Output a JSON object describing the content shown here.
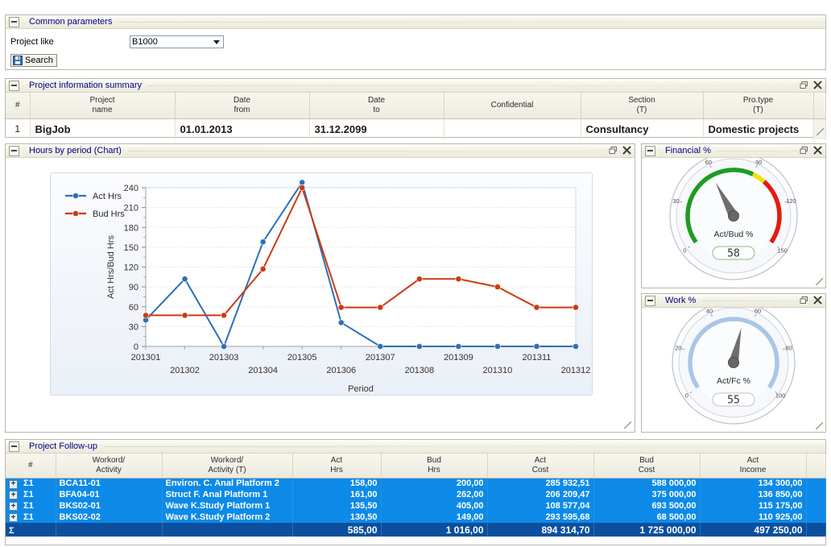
{
  "common": {
    "title": "Common parameters",
    "collapse_icon": "minus-icon",
    "project_like_label": "Project like",
    "project_like_value": "B1000",
    "search_label": "Search",
    "search_icon": "save-disk-icon"
  },
  "info": {
    "title": "Project information summary",
    "restore_icon": "restore-icon",
    "close_icon": "close-icon",
    "columns": [
      "#",
      "Project\nname",
      "Date\nfrom",
      "Date\nto",
      "Confidential",
      "Section\n(T)",
      "Pro.type\n(T)"
    ],
    "col_index": "#",
    "col_project_name_l1": "Project",
    "col_project_name_l2": "name",
    "col_date_from_l1": "Date",
    "col_date_from_l2": "from",
    "col_date_to_l1": "Date",
    "col_date_to_l2": "to",
    "col_confidential": "Confidential",
    "col_section_l1": "Section",
    "col_section_l2": "(T)",
    "col_protype_l1": "Pro.type",
    "col_protype_l2": "(T)",
    "rows": [
      {
        "index": "1",
        "project_name": "BigJob",
        "date_from": "01.01.2013",
        "date_to": "31.12.2099",
        "confidential": "",
        "section": "Consultancy",
        "pro_type": "Domestic projects"
      }
    ]
  },
  "chart_panel": {
    "title": "Hours by period (Chart)",
    "restore_icon": "restore-icon",
    "close_icon": "close-icon"
  },
  "chart_data": {
    "type": "line",
    "title": "Hours by period (Chart)",
    "xlabel": "Period",
    "ylabel": "Act Hrs/Bud Hrs",
    "ylim": [
      0,
      240
    ],
    "yticks": [
      0,
      30,
      60,
      90,
      120,
      150,
      180,
      210,
      240
    ],
    "grid": true,
    "legend_position": "top-left",
    "categories": [
      "201301",
      "201302",
      "201303",
      "201304",
      "201305",
      "201306",
      "201307",
      "201308",
      "201309",
      "201310",
      "201311",
      "201312"
    ],
    "series": [
      {
        "name": "Act Hrs",
        "color": "#2f6fb5",
        "values": [
          40,
          102,
          0,
          158,
          248,
          36,
          0,
          0,
          0,
          0,
          0,
          0
        ]
      },
      {
        "name": "Bud Hrs",
        "color": "#cc3a12",
        "values": [
          47,
          47,
          47,
          117,
          240,
          59,
          59,
          102,
          102,
          90,
          59,
          59
        ]
      }
    ]
  },
  "financial": {
    "title": "Financial %",
    "restore_icon": "restore-icon",
    "close_icon": "close-icon",
    "gauge_label": "Act/Bud %",
    "value": "58",
    "min": 0,
    "max": 150,
    "ticks": [
      "0",
      "30",
      "60",
      "90",
      "120",
      "150"
    ],
    "zones": [
      {
        "from": 0,
        "to": 90,
        "color": "#1d9c22"
      },
      {
        "from": 90,
        "to": 100,
        "color": "#f2e100"
      },
      {
        "from": 100,
        "to": 150,
        "color": "#e41b0d"
      }
    ]
  },
  "work": {
    "title": "Work %",
    "restore_icon": "restore-icon",
    "close_icon": "close-icon",
    "gauge_label": "Act/Fc %",
    "value": "55",
    "min": 0,
    "max": 100,
    "ticks": [
      "0",
      "20",
      "40",
      "60",
      "80",
      "100"
    ],
    "arc_color": "#a9c6e8"
  },
  "followup": {
    "title": "Project Follow-up",
    "columns": {
      "index": "#",
      "workord_l1": "Workord/",
      "workord_l2": "Activity",
      "workord_t_l1": "Workord/",
      "workord_t_l2": "Activity (T)",
      "act_hrs_l1": "Act",
      "act_hrs_l2": "Hrs",
      "bud_hrs_l1": "Bud",
      "bud_hrs_l2": "Hrs",
      "act_cost_l1": "Act",
      "act_cost_l2": "Cost",
      "bud_cost_l1": "Bud",
      "bud_cost_l2": "Cost",
      "act_income_l1": "Act",
      "act_income_l2": "Income"
    },
    "expand_icon": "plus-icon",
    "sum_marker": "Σ1",
    "total_marker": "Σ",
    "rows": [
      {
        "workord": "BCA11-01",
        "workord_t": "Environ. C. Anal Platform 2",
        "act_hrs": "158,00",
        "bud_hrs": "200,00",
        "act_cost": "285 932,51",
        "bud_cost": "588 000,00",
        "act_income": "134 300,00"
      },
      {
        "workord": "BFA04-01",
        "workord_t": "Struct F. Anal Platform 1",
        "act_hrs": "161,00",
        "bud_hrs": "262,00",
        "act_cost": "206 209,47",
        "bud_cost": "375 000,00",
        "act_income": "136 850,00"
      },
      {
        "workord": "BKS02-01",
        "workord_t": "Wave K.Study Platform 1",
        "act_hrs": "135,50",
        "bud_hrs": "405,00",
        "act_cost": "108 577,04",
        "bud_cost": "693 500,00",
        "act_income": "115 175,00"
      },
      {
        "workord": "BKS02-02",
        "workord_t": "Wave K.Study Platform 2",
        "act_hrs": "130,50",
        "bud_hrs": "149,00",
        "act_cost": "293 595,68",
        "bud_cost": "68 500,00",
        "act_income": "110 925,00"
      }
    ],
    "total": {
      "act_hrs": "585,00",
      "bud_hrs": "1 016,00",
      "act_cost": "894 314,70",
      "bud_cost": "1 725 000,00",
      "act_income": "497 250,00"
    }
  }
}
